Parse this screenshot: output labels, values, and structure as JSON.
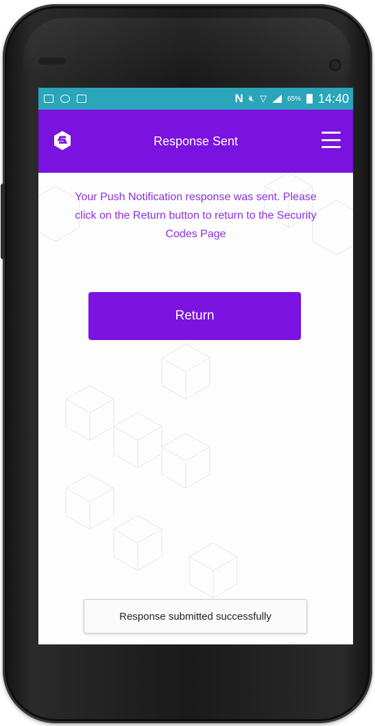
{
  "colors": {
    "status_bar": "#2aa5b9",
    "app_bar": "#7a12e0",
    "accent_text": "#8a2fe0",
    "button": "#7a12e0"
  },
  "status_bar": {
    "icons_left": [
      "gallery-icon",
      "sync-icon",
      "message-icon"
    ],
    "nfc": "N",
    "battery": "65%",
    "time": "14:40"
  },
  "app_bar": {
    "logo_icon": "shield-s-icon",
    "title": "Response Sent",
    "menu_icon": "hamburger-menu-icon"
  },
  "main": {
    "message": "Your Push Notification response was sent. Please click on the Return button to return to the Security Codes Page",
    "return_label": "Return"
  },
  "toast": {
    "text": "Response submitted successfully"
  }
}
